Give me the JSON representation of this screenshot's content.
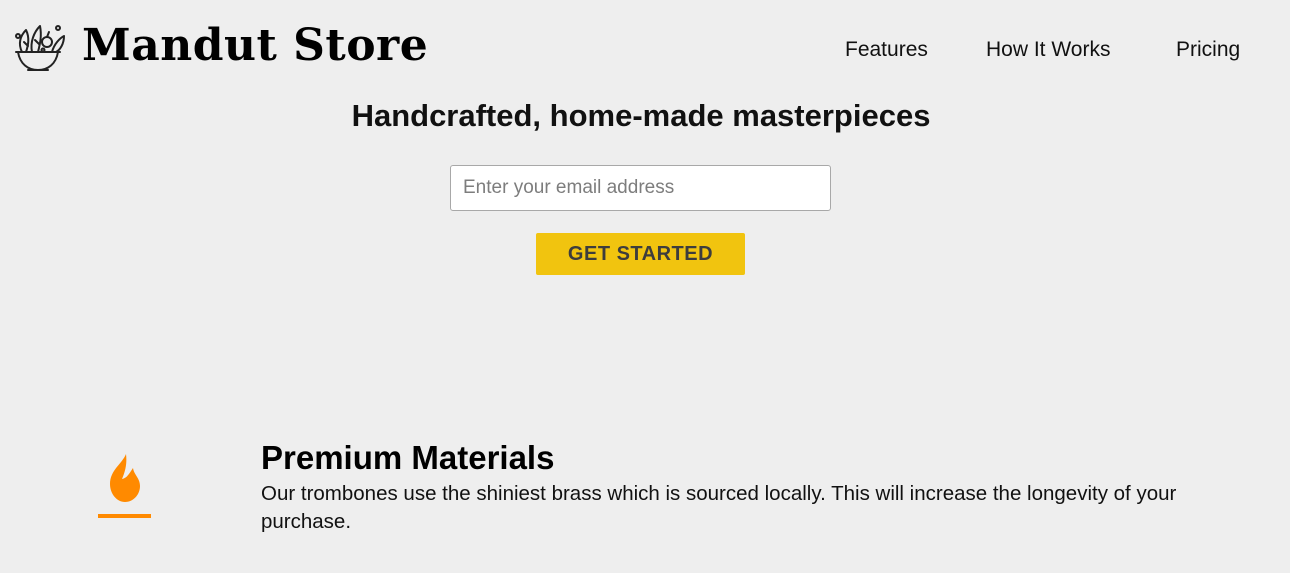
{
  "header": {
    "logo_icon": "salad-bowl-logo-icon",
    "brand": "Mandut Store",
    "nav": [
      {
        "label": "Features"
      },
      {
        "label": "How It Works"
      },
      {
        "label": "Pricing"
      }
    ]
  },
  "hero": {
    "title": "Handcrafted, home-made masterpieces",
    "email_placeholder": "Enter your email address",
    "email_value": "",
    "cta_label": "GET STARTED"
  },
  "features": [
    {
      "icon": "fire-icon",
      "title": "Premium Materials",
      "description": "Our trombones use the shiniest brass which is sourced locally. This will increase the longevity of your purchase."
    }
  ],
  "colors": {
    "background": "#eeeeee",
    "cta_background": "#f1c40f",
    "cta_text": "#3d3d3d",
    "feature_icon": "#ff8a00"
  }
}
